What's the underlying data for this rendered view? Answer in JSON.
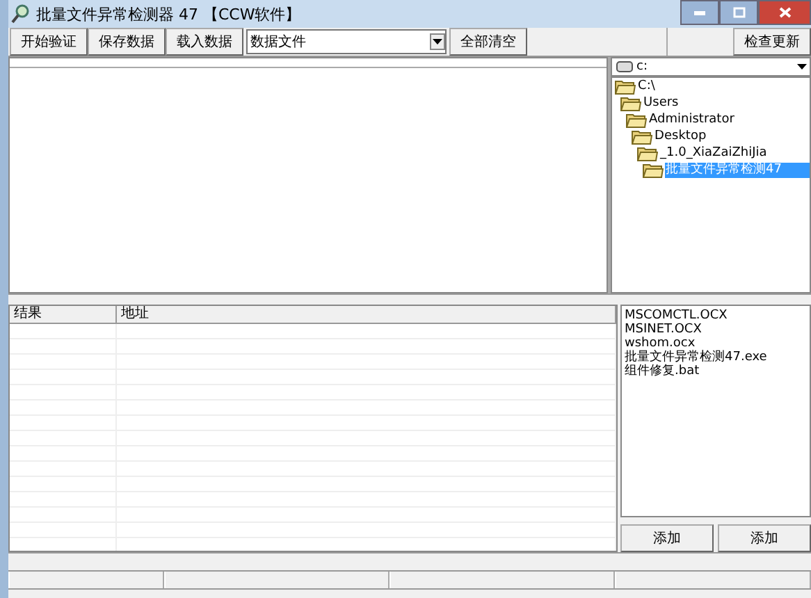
{
  "window": {
    "title": "批量文件异常检测器 47 【CCW软件】"
  },
  "toolbar": {
    "buttons": [
      "开始验证",
      "保存数据",
      "载入数据"
    ],
    "combo": {
      "value": "数据文件"
    },
    "clear_button": "全部清空",
    "update_button": "检查更新"
  },
  "drive": {
    "value": "c:"
  },
  "folders": [
    {
      "name": "C:\\",
      "selected": false,
      "children": [
        {
          "name": "Users",
          "selected": false,
          "children": [
            {
              "name": "Administrator",
              "selected": false,
              "children": [
                {
                  "name": "Desktop",
                  "selected": false,
                  "children": [
                    {
                      "name": "_1.0_XiaZaiZhiJia",
                      "selected": false,
                      "children": [
                        {
                          "name": "批量文件异常检测47",
                          "selected": true
                        }
                      ]
                    }
                  ]
                }
              ]
            }
          ]
        }
      ]
    }
  ],
  "results": {
    "columns": [
      "结果",
      "地址"
    ]
  },
  "files": [
    "MSCOMCTL.OCX",
    "MSINET.OCX",
    "wshom.ocx",
    "批量文件异常检测47.exe",
    "组件修复.bat"
  ],
  "file_buttons": [
    "添加",
    "添加"
  ]
}
